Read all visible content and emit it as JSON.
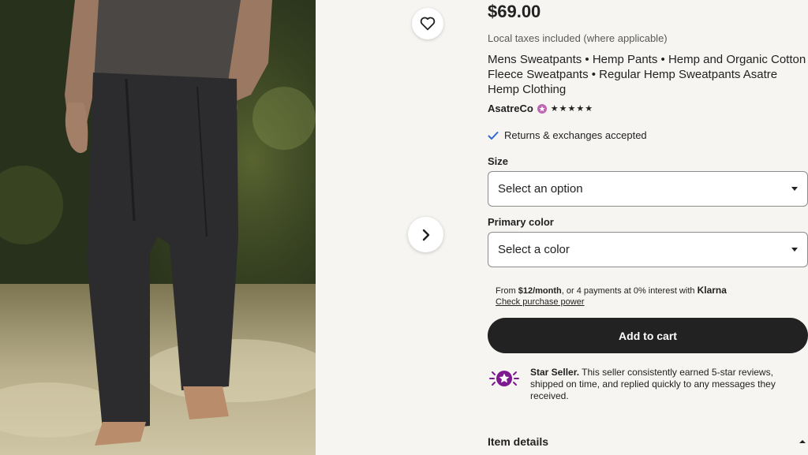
{
  "product": {
    "price": "$69.00",
    "tax_note": "Local taxes included (where applicable)",
    "title": "Mens Sweatpants • Hemp Pants • Hemp and Organic Cotton Fleece Sweatpants • Regular Hemp Sweatpants Asatre Hemp Clothing",
    "image_alt": "Man wearing charcoal hemp sweatpants standing barefoot on a forest path"
  },
  "shop": {
    "name": "AsatreCo",
    "rating_stars": "★★★★★",
    "rating": 5,
    "badge_color": "#c064b5"
  },
  "returns": {
    "text": "Returns & exchanges accepted",
    "icon": "check-icon",
    "icon_color": "#2f66d0"
  },
  "size": {
    "label": "Size",
    "placeholder": "Select an option"
  },
  "color": {
    "label": "Primary color",
    "placeholder": "Select a color"
  },
  "klarna": {
    "prefix": "From ",
    "amount": "$12/month",
    "middle": ", or 4 payments at 0% interest with ",
    "brand": "Klarna",
    "link": "Check purchase power"
  },
  "cart": {
    "button": "Add to cart",
    "button_bg": "#222222"
  },
  "star_seller": {
    "title": "Star Seller.",
    "body": " This seller consistently earned 5-star reviews, shipped on time, and replied quickly to any messages they received.",
    "icon": "star-seller-icon",
    "accent": "#7d1a8f"
  },
  "details": {
    "label": "Item details",
    "icon": "chevron-up-icon"
  },
  "gallery": {
    "favorite_icon": "heart-icon",
    "next_icon": "chevron-right-icon"
  }
}
